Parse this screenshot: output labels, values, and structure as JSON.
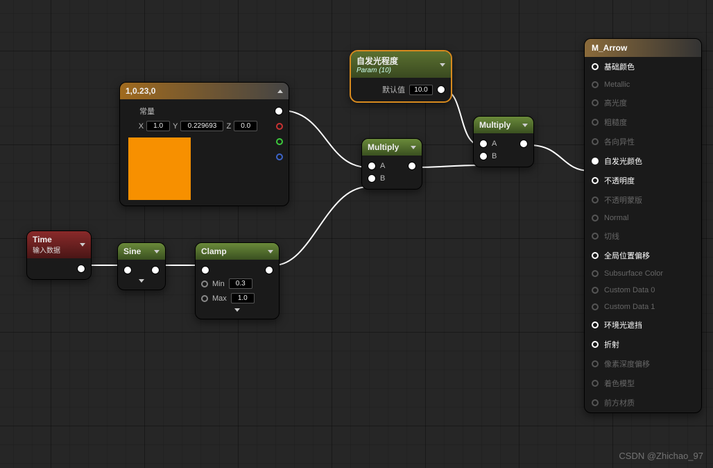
{
  "watermark": "CSDN @Zhichao_97",
  "const": {
    "title": "1,0.23,0",
    "section": "常量",
    "xl": "X",
    "yl": "Y",
    "zl": "Z",
    "x": "1.0",
    "y": "0.229693",
    "z": "0.0",
    "swatch": "#f79000"
  },
  "param": {
    "title": "自发光程度",
    "sub": "Param (10)",
    "default_label": "默认值",
    "default": "10.0"
  },
  "time": {
    "title": "Time",
    "sub": "输入数据"
  },
  "sine": {
    "title": "Sine"
  },
  "clamp": {
    "title": "Clamp",
    "min_l": "Min",
    "min": "0.3",
    "max_l": "Max",
    "max": "1.0"
  },
  "mult1": {
    "title": "Multiply",
    "a": "A",
    "b": "B"
  },
  "mult2": {
    "title": "Multiply",
    "a": "A",
    "b": "B"
  },
  "output": {
    "title": "M_Arrow",
    "items": [
      {
        "label": "基础颜色",
        "active": true
      },
      {
        "label": "Metallic",
        "active": false
      },
      {
        "label": "高光度",
        "active": false
      },
      {
        "label": "粗糙度",
        "active": false
      },
      {
        "label": "各向异性",
        "active": false
      },
      {
        "label": "自发光颜色",
        "active": true,
        "filled": true
      },
      {
        "label": "不透明度",
        "active": true
      },
      {
        "label": "不透明蒙版",
        "active": false
      },
      {
        "label": "Normal",
        "active": false
      },
      {
        "label": "切线",
        "active": false
      },
      {
        "label": "全局位置偏移",
        "active": true
      },
      {
        "label": "Subsurface Color",
        "active": false
      },
      {
        "label": "Custom Data 0",
        "active": false
      },
      {
        "label": "Custom Data 1",
        "active": false
      },
      {
        "label": "环境光遮挡",
        "active": true
      },
      {
        "label": "折射",
        "active": true
      },
      {
        "label": "像素深度偏移",
        "active": false
      },
      {
        "label": "着色模型",
        "active": false
      },
      {
        "label": "前方材质",
        "active": false
      }
    ]
  }
}
